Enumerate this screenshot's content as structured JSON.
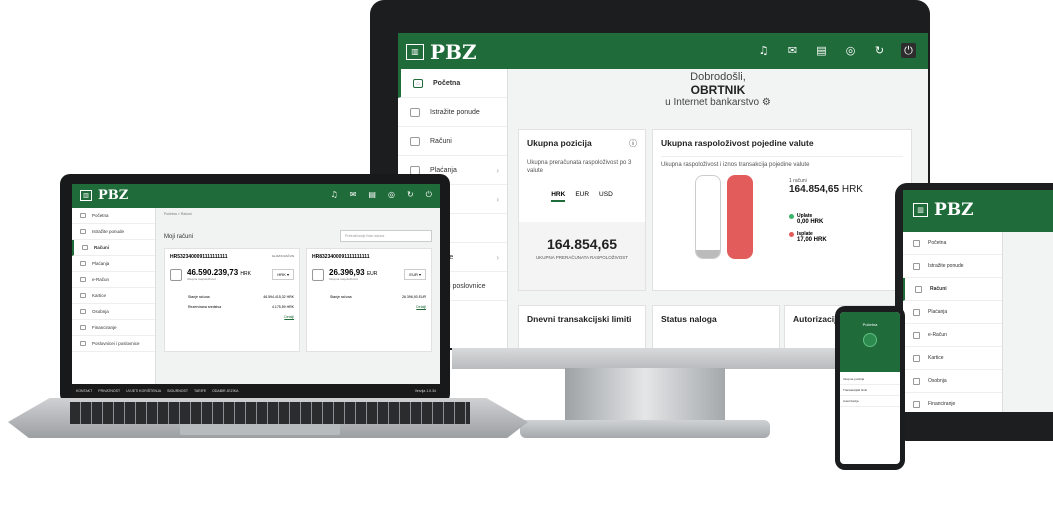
{
  "brand": {
    "name": "PBZ",
    "mark": "▥",
    "color": "#1f6b3a"
  },
  "monitor": {
    "welcome": {
      "line1": "Dobrodošli,",
      "line2": "OBRTNIK",
      "line3": "u Internet bankarstvo"
    },
    "sidebar": [
      {
        "label": "Početna",
        "active": true
      },
      {
        "label": "Istražite ponude"
      },
      {
        "label": "Računi"
      },
      {
        "label": "Plaćanja"
      },
      {
        "label": ""
      },
      {
        "label": ""
      },
      {
        "label": "anje"
      },
      {
        "label": "ali i poslovnice"
      }
    ],
    "position_card": {
      "title": "Ukupna pozicija",
      "subtitle": "Ukupna preračunata raspoloživost po 3 valute",
      "tabs": [
        "HRK",
        "EUR",
        "USD"
      ],
      "amount": "164.854,65",
      "amount_label": "UKUPNA PRERAČUNATA RASPOLOŽIVOST"
    },
    "availability_card": {
      "title": "Ukupna raspoloživost pojedine valute",
      "subtitle": "Ukupna raspoloživost i iznos transakcija pojedine valute",
      "accounts_label": "1 računi",
      "total": "164.854,65",
      "total_currency": "HRK",
      "payin_label": "Uplate",
      "payin_amount": "0,00 HRK",
      "payout_label": "Isplate",
      "payout_amount": "17,00 HRK",
      "payin_color": "#3bb36a",
      "payout_color": "#e35c5c"
    },
    "bottom_cards": [
      "Dnevni transakcijski limiti",
      "Status naloga",
      "Autorizacij"
    ]
  },
  "laptop": {
    "breadcrumb": "Početna > Računi",
    "title": "Moji računi",
    "search_placeholder": "Pretraživanje lista računa",
    "sidebar": [
      "Početna",
      "Istražite ponude",
      "Računi",
      "Plaćanja",
      "e-Račun",
      "Kartice",
      "Osobnja",
      "Financiranje",
      "Poslovnicei i poslovnice"
    ],
    "account1": {
      "iban": "HR5323400091111111111",
      "badge": "GLAVNI RAČUN",
      "amount": "46.590.239,73",
      "currency": "HRK",
      "sub": "Ukupna raspoloživost",
      "select": "HRK ▾",
      "row1_label": "Stanje računa",
      "row1_value": "46.594.415,32 HRK",
      "row2_label": "Rezervirana sredstva",
      "row2_value": "4.175,59 HRK",
      "link": "Detalji"
    },
    "account2": {
      "iban": "HR8323400091111111111",
      "amount": "26.396,93",
      "currency": "EUR",
      "sub": "Ukupna raspoloživost",
      "select": "EUR ▾",
      "row1_label": "Stanje računa",
      "row1_value": "26.396,93 EUR",
      "link": "Detalji"
    },
    "footer": [
      "KONTAKT",
      "PRIVATNOST",
      "UVJETI KORIŠTENJA",
      "SIGURNOST",
      "TARIFE",
      "ODABIR JEZIKA"
    ],
    "footer_right": "Verzija 1.0.34"
  },
  "tablet": {
    "sidebar": [
      "Početna",
      "Istražite ponude",
      "Računi",
      "Plaćanja",
      "e-Račun",
      "Kartice",
      "Osobnja",
      "Financiranje"
    ]
  },
  "phone": {
    "title": "Početna",
    "items": [
      "Ukupna pozicija",
      "Transakcijski limiti",
      "Autorizacija"
    ]
  }
}
